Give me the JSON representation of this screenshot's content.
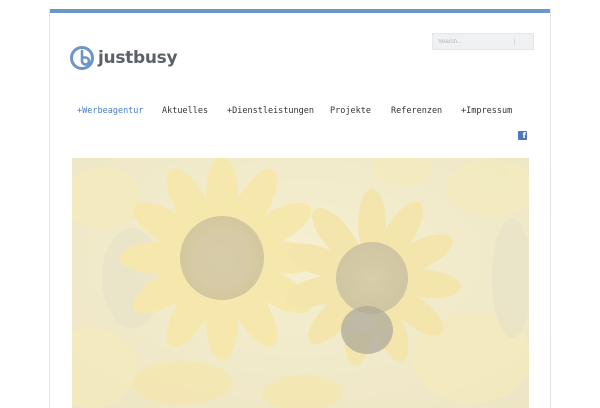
{
  "header": {
    "brand_name": "justbusy",
    "logo_icon": "spiral-logo-icon",
    "accent_color": "#6c95c9"
  },
  "search": {
    "placeholder": "Search..."
  },
  "nav": {
    "items": [
      {
        "label": "Werbeagentur",
        "prefix": "+",
        "active": true
      },
      {
        "label": "Aktuelles",
        "prefix": "",
        "active": false
      },
      {
        "label": "Dienstleistungen",
        "prefix": "+",
        "active": false
      },
      {
        "label": "Projekte",
        "prefix": "",
        "active": false
      },
      {
        "label": "Referenzen",
        "prefix": "",
        "active": false
      },
      {
        "label": "Impressum",
        "prefix": "+",
        "active": false
      }
    ],
    "active_color": "#4a7ec4"
  },
  "social": {
    "facebook_icon": "facebook-icon",
    "facebook_glyph": "f",
    "facebook_color": "#4c77b8"
  },
  "hero": {
    "image_subject": "sunflowers-image"
  }
}
